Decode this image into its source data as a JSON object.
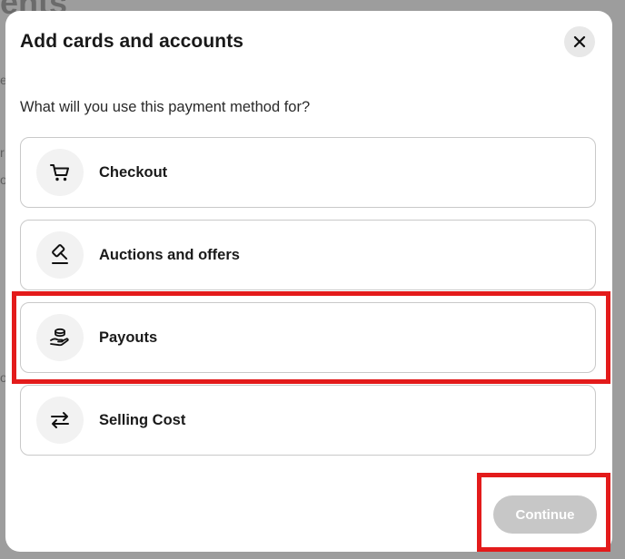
{
  "background": {
    "title_fragment": "ents",
    "side_fragments": [
      "e",
      "r",
      "o",
      "o"
    ]
  },
  "modal": {
    "title": "Add cards and accounts",
    "close_icon": "close-icon",
    "question": "What will you use this payment method for?",
    "options": [
      {
        "label": "Checkout",
        "icon": "cart-icon"
      },
      {
        "label": "Auctions and offers",
        "icon": "gavel-icon"
      },
      {
        "label": "Payouts",
        "icon": "payout-hand-coin-icon"
      },
      {
        "label": "Selling Cost",
        "icon": "swap-arrows-icon"
      }
    ],
    "continue_label": "Continue",
    "continue_enabled": false
  },
  "annotations": {
    "highlight_color": "#e31b1b",
    "highlighted": [
      "Payouts",
      "Continue"
    ]
  }
}
